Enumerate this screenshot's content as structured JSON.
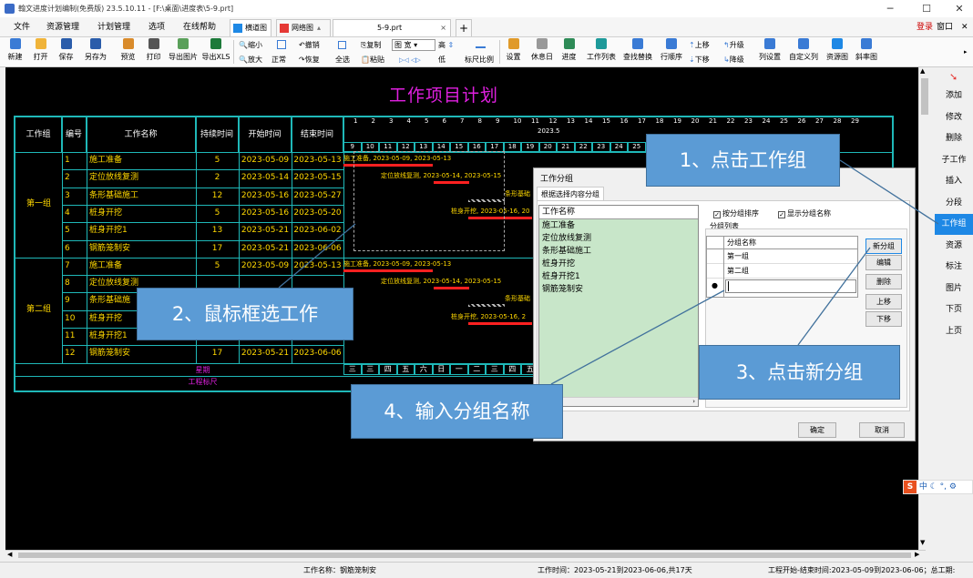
{
  "window": {
    "title": "翰文进度计划编制(免费版) 23.5.10.11 - [F:\\桌面\\进度表\\5-9.prt]",
    "login": "登录",
    "window_menu": "窗口"
  },
  "menu": [
    "文件",
    "资源管理",
    "计划管理",
    "选项",
    "在线帮助"
  ],
  "tabs": {
    "gantt": "横道图",
    "network": "网络图",
    "file": "5-9.prt"
  },
  "toolbar": {
    "row1": [
      "新建",
      "打开",
      "保存",
      "另存为",
      "预览",
      "打印",
      "导出图片",
      "导出XLS"
    ],
    "zoom": {
      "shrink": "缩小",
      "enlarge": "放大",
      "fit": "缩小",
      "normal": "正常"
    },
    "edit": {
      "undo": "撤销",
      "redo": "恢复",
      "copy": "复制",
      "paste": "粘贴",
      "select_all": "全选"
    },
    "view": {
      "mode": "图 宽",
      "high": "高",
      "low": "低",
      "ruler": "标尺比例"
    },
    "right": [
      "设置",
      "休息日",
      "进度",
      "工作列表",
      "查找替换",
      "行顺序",
      "上移",
      "下移",
      "升级",
      "降级",
      "列设置",
      "自定义列",
      "资源图",
      "斜率图"
    ]
  },
  "sidebar": [
    "添加",
    "修改",
    "删除",
    "子工作",
    "插入",
    "分段",
    "工作组",
    "资源",
    "标注",
    "图片",
    "下页",
    "上页"
  ],
  "sidebar_active": "工作组",
  "chart": {
    "title": "工作项目计划",
    "month": "2023.5",
    "headers": [
      "工作组",
      "编号",
      "工作名称",
      "持续时间",
      "开始时间",
      "结束时间"
    ],
    "day_top": [
      "1",
      "2",
      "3",
      "4",
      "5",
      "6",
      "7",
      "8",
      "9",
      "10",
      "11",
      "12",
      "13",
      "14",
      "15",
      "16",
      "17",
      "18",
      "19",
      "20",
      "21",
      "22",
      "23",
      "24",
      "25",
      "26",
      "27",
      "28",
      "29"
    ],
    "day_bot": [
      "9",
      "10",
      "11",
      "12",
      "13",
      "14",
      "15",
      "16",
      "17",
      "18",
      "19",
      "20",
      "21",
      "22",
      "23",
      "24",
      "25"
    ],
    "groups": [
      {
        "name": "第一组",
        "rows": [
          {
            "id": "1",
            "name": "施工准备",
            "dur": "5",
            "start": "2023-05-09",
            "end": "2023-05-13"
          },
          {
            "id": "2",
            "name": "定位放线复测",
            "dur": "2",
            "start": "2023-05-14",
            "end": "2023-05-15"
          },
          {
            "id": "3",
            "name": "条形基础施工",
            "dur": "12",
            "start": "2023-05-16",
            "end": "2023-05-27"
          },
          {
            "id": "4",
            "name": "桩身开挖",
            "dur": "5",
            "start": "2023-05-16",
            "end": "2023-05-20"
          },
          {
            "id": "5",
            "name": "桩身开挖1",
            "dur": "13",
            "start": "2023-05-21",
            "end": "2023-06-02"
          },
          {
            "id": "6",
            "name": "钢筋笼制安",
            "dur": "17",
            "start": "2023-05-21",
            "end": "2023-06-06"
          }
        ]
      },
      {
        "name": "第二组",
        "rows": [
          {
            "id": "7",
            "name": "施工准备",
            "dur": "5",
            "start": "2023-05-09",
            "end": "2023-05-13"
          },
          {
            "id": "8",
            "name": "定位放线复测",
            "dur": "",
            "start": "",
            "end": ""
          },
          {
            "id": "9",
            "name": "条形基础施",
            "dur": "",
            "start": "",
            "end": ""
          },
          {
            "id": "10",
            "name": "桩身开挖",
            "dur": "",
            "start": "",
            "end": ""
          },
          {
            "id": "11",
            "name": "桩身开挖1",
            "dur": "",
            "start": "",
            "end": ""
          },
          {
            "id": "12",
            "name": "钢筋笼制安",
            "dur": "17",
            "start": "2023-05-21",
            "end": "2023-06-06"
          }
        ]
      }
    ],
    "bar_labels": {
      "r1": "施工准备, 2023-05-09, 2023-05-13",
      "r2": "定位放线复测, 2023-05-14, 2023-05-15",
      "r3": "条形基础",
      "r4": "桩身开挖, 2023-05-16, 20",
      "r7": "施工准备, 2023-05-09, 2023-05-13",
      "r8": "定位放线复测, 2023-05-14, 2023-05-15",
      "r9": "条形基础",
      "r10": "桩身开挖, 2023-05-16, 2"
    },
    "footer": {
      "week": "星期",
      "weekdays": [
        "三",
        "三",
        "四",
        "五",
        "六",
        "日",
        "一",
        "二",
        "三",
        "四",
        "五"
      ],
      "ruler": "工程标尺"
    }
  },
  "dialog": {
    "title": "工作分组",
    "tab": "根据选择内容分组",
    "list_header": "工作名称",
    "list": [
      "施工准备",
      "定位放线复测",
      "条形基础施工",
      "桩身开挖",
      "桩身开挖1",
      "钢筋笼制安"
    ],
    "chk_sort": "按分组排序",
    "chk_show": "显示分组名称",
    "group_list_label": "分组列表",
    "group_header": "分组名称",
    "groups": [
      "第一组",
      "第二组"
    ],
    "buttons": {
      "new": "新分组",
      "edit": "编辑",
      "delete": "删除",
      "up": "上移",
      "down": "下移",
      "ok": "确定",
      "cancel": "取消"
    }
  },
  "callouts": {
    "c1": "1、点击工作组",
    "c2": "2、鼠标框选工作",
    "c3": "3、点击新分组",
    "c4": "4、输入分组名称"
  },
  "status": {
    "name": "工作名称：钢筋笼制安",
    "time": "工作时间：2023-05-21到2023-06-06,共17天",
    "range": "工程开始-结束时间:2023-05-09到2023-06-06；总工期:"
  },
  "ime": "中"
}
